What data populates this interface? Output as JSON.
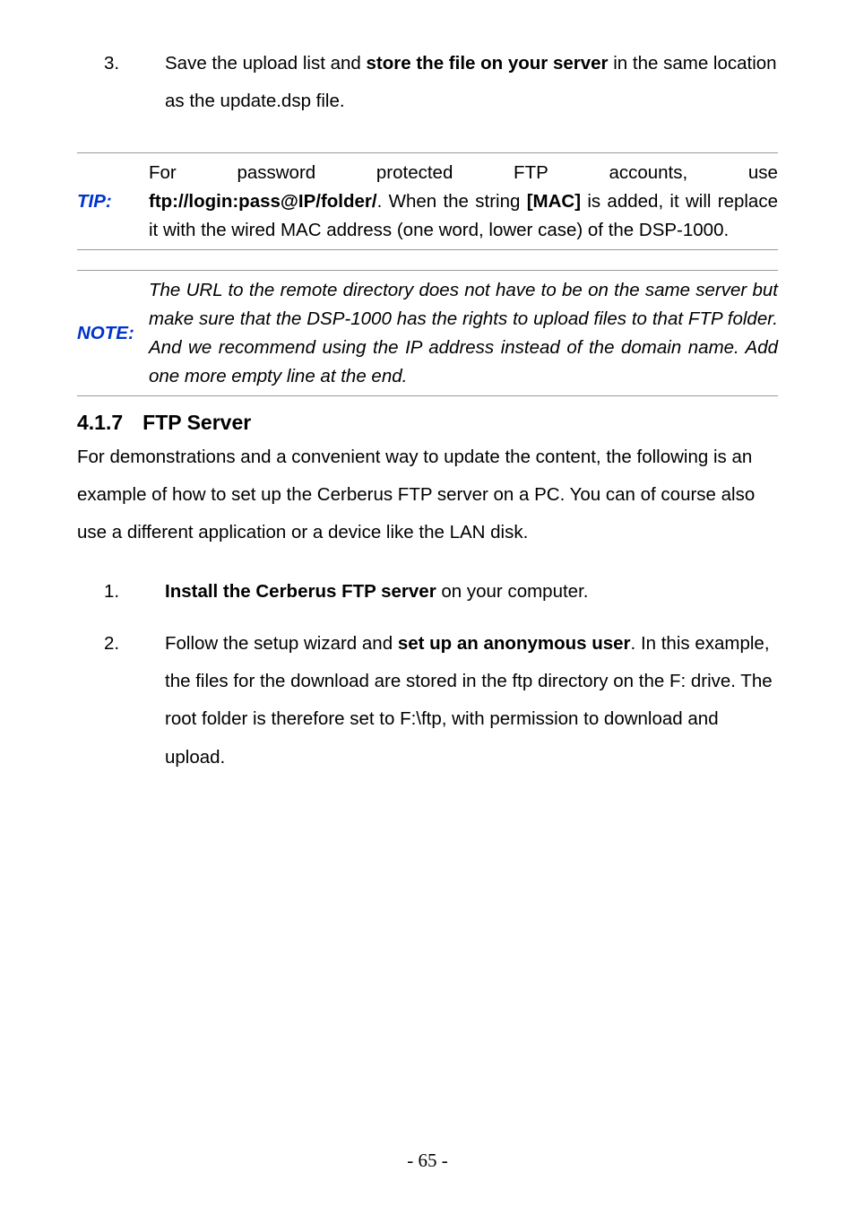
{
  "ol_top": {
    "num": "3.",
    "text_a": "Save the upload list and ",
    "text_bold": "store the file on your server",
    "text_b": " in the same location as the update.dsp file."
  },
  "tip": {
    "label": "TIP:",
    "line1_a": "For",
    "line1_b": "password",
    "line1_c": "protected",
    "line1_d": "FTP",
    "line1_e": "accounts,",
    "line1_f": "use",
    "bold_url": "ftp://login:pass@IP/folder/",
    "mid_a": ". When the string ",
    "bold_mac": "[MAC]",
    "mid_b": " is added, it will replace it with the wired MAC address (one word, lower case) of the DSP-1000."
  },
  "note": {
    "label": "NOTE:",
    "body": "The URL to the remote directory does not have to be on the same server but make sure that the DSP-1000 has the rights to upload files to that FTP folder. And we recommend using the IP address instead of the domain name. Add one more empty line at the end."
  },
  "heading": {
    "num": "4.1.7",
    "text": "FTP Server"
  },
  "para": "For demonstrations and a convenient way to update the content, the following is an example of how to set up the Cerberus FTP server on a PC. You can of course also use a different application or a device like the LAN disk.",
  "sub_ol": {
    "item1": {
      "num": "1.",
      "bold": "Install the Cerberus FTP server",
      "after": " on your computer."
    },
    "item2": {
      "num": "2.",
      "before": "Follow the setup wizard and ",
      "bold": "set up an anonymous user",
      "after": ". In this example, the files for the download are stored in the ftp directory on the F: drive. The root folder is therefore set to F:\\ftp, with permission to download and upload."
    }
  },
  "page_number": "- 65 -"
}
